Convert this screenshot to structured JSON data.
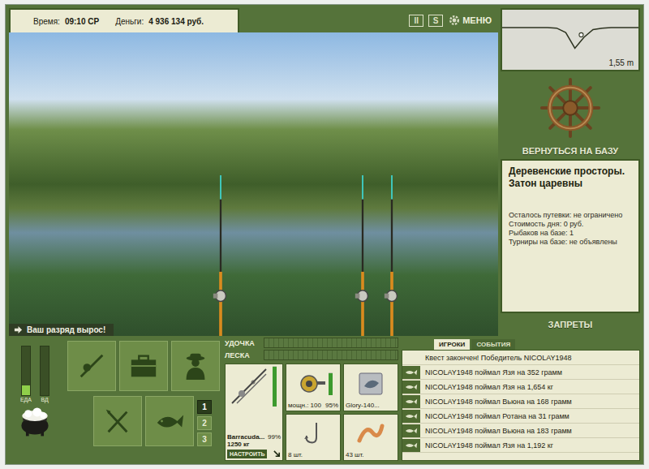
{
  "status": {
    "time_label": "Время:",
    "time": "09:10 СР",
    "money_label": "Деньги:",
    "money": "4 936 134 руб."
  },
  "top_controls": [
    {
      "label": "II",
      "kind": "pause"
    },
    {
      "label": "S",
      "kind": "sound"
    },
    {
      "label": "МЕНЮ",
      "kind": "menu"
    }
  ],
  "depth": {
    "reading": "1,55 m",
    "values": [
      0.7,
      0.7,
      0.7,
      0.7,
      0.7,
      0.7,
      0.72,
      0.9,
      1.55,
      1.1,
      0.78,
      0.72,
      0.7,
      0.7,
      0.7,
      0.7
    ],
    "marker_level": 0.58
  },
  "location": {
    "return_button": "ВЕРНУТЬСЯ НА БАЗУ",
    "name": "Деревенские просторы. Затон царевны",
    "details": [
      "Осталось путевки: не ограничено",
      "Стоимость дня: 0 руб.",
      "Рыбаков на базе: 1",
      "Турниры на базе: не объявлены"
    ],
    "bans_button": "ЗАПРЕТЫ"
  },
  "notification": "Ваш разряд вырос!",
  "needs": [
    {
      "label": "ЕДА",
      "level": 0.2
    },
    {
      "label": "ВД",
      "level": 0.0
    }
  ],
  "slots": [
    {
      "label": "1",
      "selected": true
    },
    {
      "label": "2",
      "selected": false
    },
    {
      "label": "3",
      "selected": false
    }
  ],
  "meters": [
    {
      "label": "УДОЧКА",
      "level": 0.0
    },
    {
      "label": "ЛЕСКА",
      "level": 0.0
    }
  ],
  "rod": {
    "name": "Barracuda...",
    "capacity": "1250 кг",
    "condition": "99%",
    "level": 0.99,
    "setup_button": "НАСТРОИТЬ"
  },
  "tackle": [
    {
      "kind": "reel",
      "caption": "мощн.: 100",
      "condition": "95%",
      "level": 0.95
    },
    {
      "kind": "lure",
      "caption": "Glory-140...",
      "condition": "",
      "level": 0
    },
    {
      "kind": "hook",
      "caption": "8 шт.",
      "condition": "",
      "level": 0
    },
    {
      "kind": "bait",
      "caption": "43 шт.",
      "condition": "",
      "level": 0
    }
  ],
  "feed": {
    "tabs": [
      {
        "label": "ИГРОКИ",
        "selected": true
      },
      {
        "label": "СОБЫТИЯ",
        "selected": false
      }
    ],
    "entries": [
      {
        "kind": "notice",
        "text": "Квест закончен! Победитель NICOLAY1948"
      },
      {
        "kind": "catch",
        "text": "NICOLAY1948 поймал Язя на 352 грамм"
      },
      {
        "kind": "catch",
        "text": "NICOLAY1948 поймал Язя на 1,654 кг"
      },
      {
        "kind": "catch",
        "text": "NICOLAY1948 поймал Вьюна на 168 грамм"
      },
      {
        "kind": "catch",
        "text": "NICOLAY1948 поймал Ротана на 31 грамм"
      },
      {
        "kind": "catch",
        "text": "NICOLAY1948 поймал Вьюна на 183 грамм"
      },
      {
        "kind": "catch",
        "text": "NICOLAY1948 поймал Язя на 1,192 кг"
      }
    ]
  }
}
